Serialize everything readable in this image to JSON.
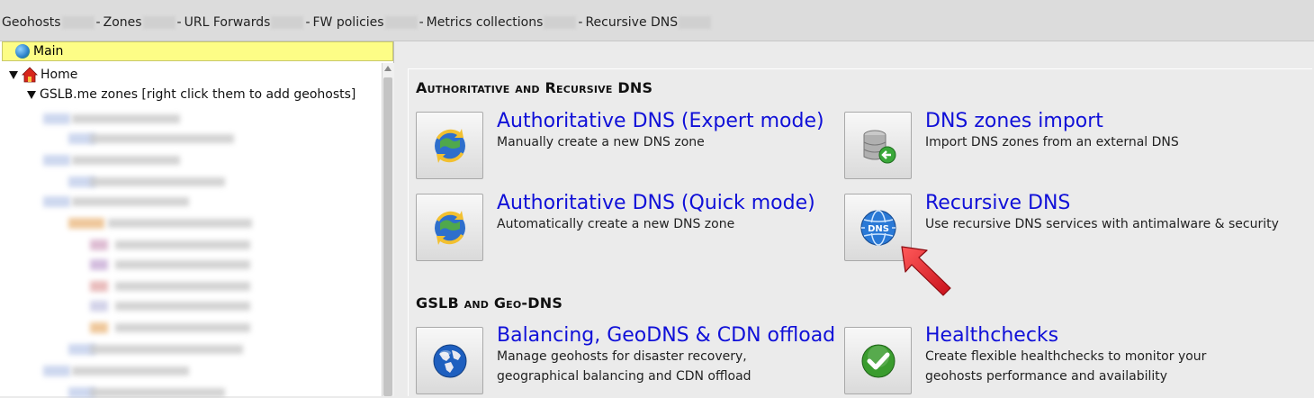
{
  "nav": {
    "items": [
      "Geohosts",
      "Zones",
      "URL Forwards",
      "FW policies",
      "Metrics collections",
      "Recursive DNS"
    ],
    "separator": "-"
  },
  "sidebar": {
    "main_tab": "Main",
    "tree": {
      "home": "Home",
      "zones_node": "GSLB.me zones [right click them to add geohosts]"
    }
  },
  "sections": [
    {
      "title": "Authoritative and Recursive DNS",
      "tiles": [
        {
          "title": "Authoritative DNS (Expert mode)",
          "desc": [
            "Manually create a new DNS zone"
          ],
          "icon": "globe-sync-icon"
        },
        {
          "title": "DNS zones import",
          "desc": [
            "Import DNS zones from an external DNS"
          ],
          "icon": "database-import-icon"
        },
        {
          "title": "Authoritative DNS (Quick mode)",
          "desc": [
            "Automatically create a new DNS zone"
          ],
          "icon": "globe-sync-icon"
        },
        {
          "title": "Recursive DNS",
          "desc": [
            "Use recursive DNS services with antimalware & security"
          ],
          "icon": "dns-globe-icon",
          "label": "DNS"
        }
      ]
    },
    {
      "title": "GSLB and Geo-DNS",
      "tiles": [
        {
          "title": "Balancing, GeoDNS & CDN offload",
          "desc": [
            "Manage geohosts for disaster recovery,",
            "geographical balancing and CDN offload"
          ],
          "icon": "world-globe-icon"
        },
        {
          "title": "Healthchecks",
          "desc": [
            "Create flexible healthchecks to monitor your",
            "geohosts performance and availability"
          ],
          "icon": "checkmark-icon"
        }
      ]
    }
  ],
  "colors": {
    "link": "#1010d8",
    "main_tab": "#fdfd86",
    "arrow": "#e01a24"
  }
}
